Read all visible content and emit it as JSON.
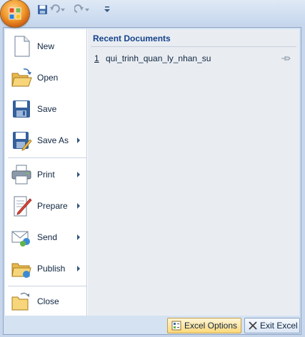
{
  "quick_access": {
    "save_icon": "save-icon",
    "undo_icon": "undo-icon",
    "redo_icon": "redo-icon",
    "customize_icon": "customize-qat-icon"
  },
  "menu": {
    "commands": [
      {
        "id": "new",
        "label": "New",
        "icon": "new-document-icon",
        "has_submenu": false
      },
      {
        "id": "open",
        "label": "Open",
        "icon": "open-folder-icon",
        "has_submenu": false
      },
      {
        "id": "save",
        "label": "Save",
        "icon": "save-disk-icon",
        "has_submenu": false
      },
      {
        "id": "save-as",
        "label": "Save As",
        "icon": "save-as-icon",
        "has_submenu": true
      },
      {
        "id": "print",
        "label": "Print",
        "icon": "printer-icon",
        "has_submenu": true
      },
      {
        "id": "prepare",
        "label": "Prepare",
        "icon": "prepare-document-icon",
        "has_submenu": true
      },
      {
        "id": "send",
        "label": "Send",
        "icon": "send-icon",
        "has_submenu": true
      },
      {
        "id": "publish",
        "label": "Publish",
        "icon": "publish-folder-icon",
        "has_submenu": true
      },
      {
        "id": "close",
        "label": "Close",
        "icon": "close-folder-icon",
        "has_submenu": false
      }
    ]
  },
  "recent": {
    "heading": "Recent Documents",
    "items": [
      {
        "number": "1",
        "name": "qui_trinh_quan_ly_nhan_su",
        "icon": "pin-icon"
      }
    ]
  },
  "footer": {
    "options_label": "Excel Options",
    "exit_label": "Exit Excel"
  },
  "colors": {
    "accent": "#15428b",
    "office_button": "#f29a2b",
    "menu_background": "#d5e2f2"
  }
}
